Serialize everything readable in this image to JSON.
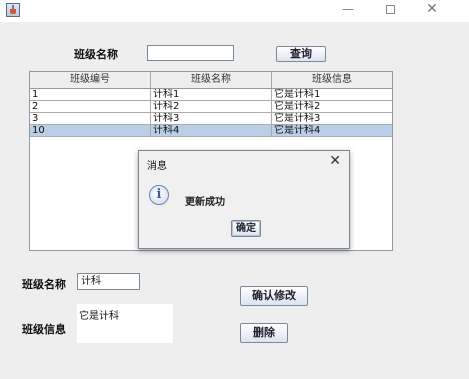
{
  "window": {
    "minimize_glyph": "—",
    "close_glyph": "✕"
  },
  "search": {
    "label": "班级名称",
    "value": "",
    "button_label": "查询"
  },
  "table": {
    "headers": [
      "班级编号",
      "班级名称",
      "班级信息"
    ],
    "rows": [
      [
        "1",
        "计科1",
        "它是计科1"
      ],
      [
        "2",
        "计科2",
        "它是计科2"
      ],
      [
        "3",
        "计科3",
        "它是计科3"
      ],
      [
        "10",
        "计科4",
        "它是计科4"
      ]
    ],
    "selected_row": 3
  },
  "dialog": {
    "title": "消息",
    "close_glyph": "✕",
    "info_glyph": "i",
    "message": "更新成功",
    "ok_label": "确定"
  },
  "form": {
    "name_label": "班级名称",
    "name_value": "计科",
    "info_label": "班级信息",
    "info_value": "它是计科",
    "confirm_label": "确认修改",
    "delete_label": "删除"
  },
  "colors": {
    "selected_row": "#b8cfe5",
    "background": "#eeeeee"
  }
}
